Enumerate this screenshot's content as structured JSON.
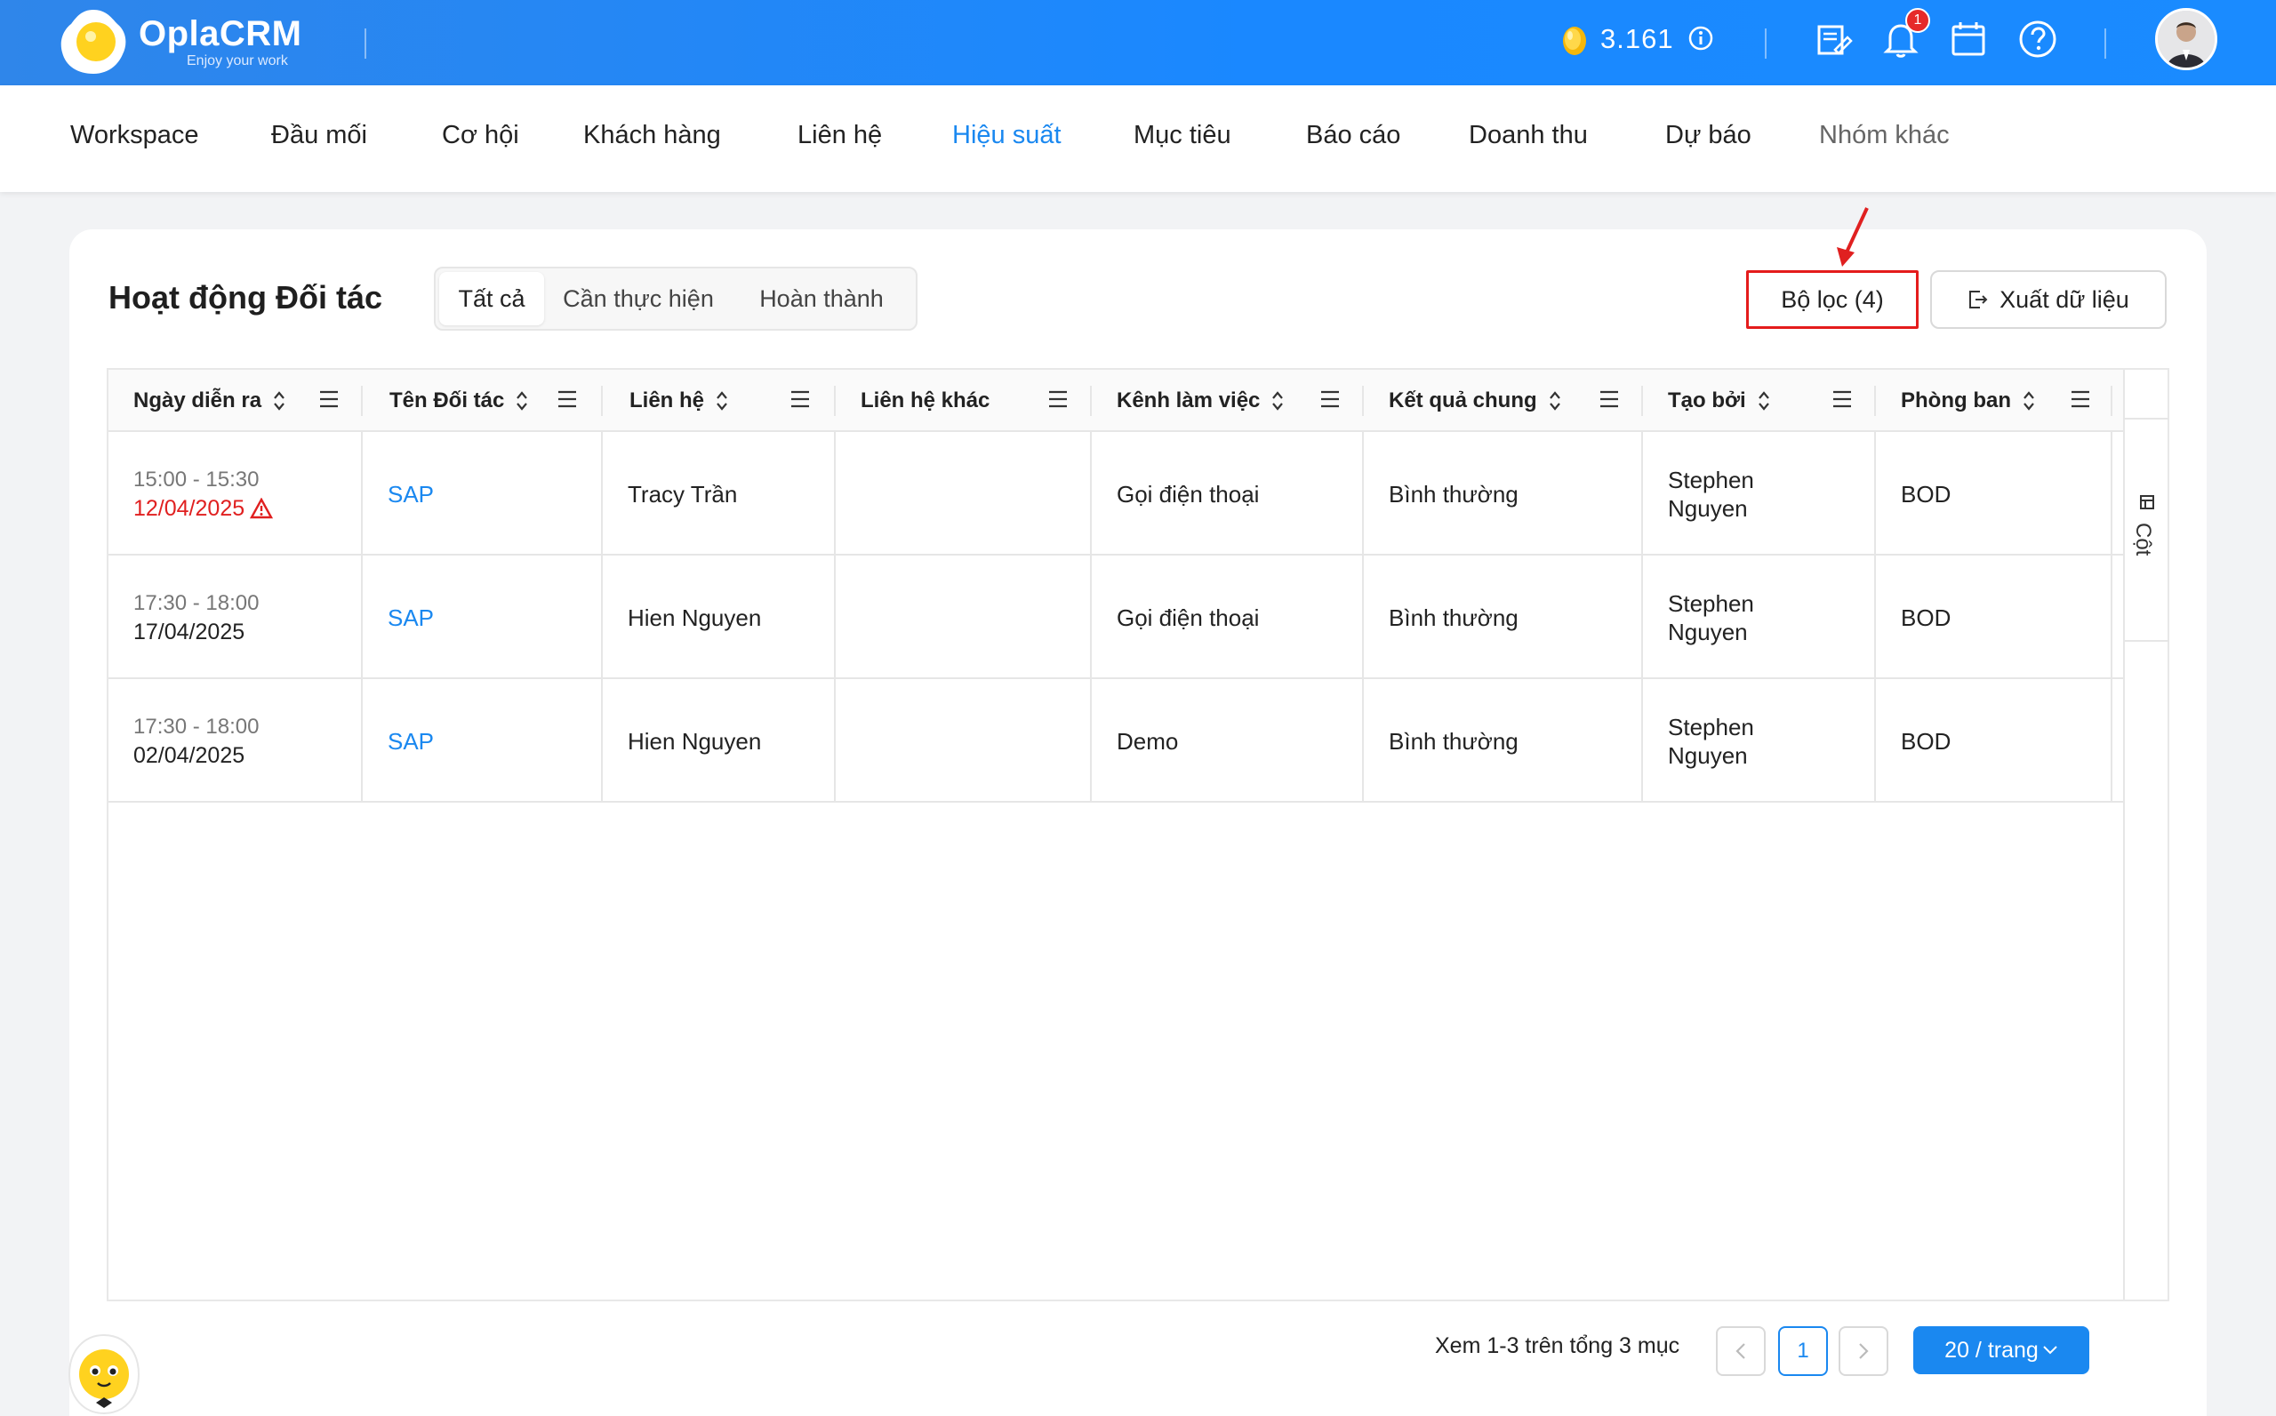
{
  "app": {
    "name": "OplaCRM",
    "tagline": "Enjoy your work",
    "coins": "3.161",
    "notification_count": "1"
  },
  "nav": {
    "items": [
      "Workspace",
      "Đầu mối",
      "Cơ hội",
      "Khách hàng",
      "Liên hệ",
      "Hiệu suất",
      "Mục tiêu",
      "Báo cáo",
      "Doanh thu",
      "Dự báo",
      "Nhóm khác"
    ],
    "active": "Hiệu suất"
  },
  "page": {
    "title": "Hoạt động Đối tác",
    "tabs": [
      "Tất cả",
      "Cần thực hiện",
      "Hoàn thành"
    ],
    "active_tab": "Tất cả",
    "filter_label": "Bộ lọc (4)",
    "export_label": "Xuất dữ liệu"
  },
  "table": {
    "columns": [
      "Ngày diễn ra",
      "Tên Đối tác",
      "Liên hệ",
      "Liên hệ khác",
      "Kênh làm việc",
      "Kết quả chung",
      "Tạo bởi",
      "Phòng ban"
    ],
    "rows": [
      {
        "time": "15:00 - 15:30",
        "date": "12/04/2025",
        "overdue": true,
        "partner": "SAP",
        "contact": "Tracy Trần",
        "other_contact": "",
        "channel": "Gọi điện thoại",
        "result": "Bình thường",
        "created_by": "Stephen Nguyen",
        "department": "BOD"
      },
      {
        "time": "17:30 - 18:00",
        "date": "17/04/2025",
        "overdue": false,
        "partner": "SAP",
        "contact": "Hien Nguyen",
        "other_contact": "",
        "channel": "Gọi điện thoại",
        "result": "Bình thường",
        "created_by": "Stephen Nguyen",
        "department": "BOD"
      },
      {
        "time": "17:30 - 18:00",
        "date": "02/04/2025",
        "overdue": false,
        "partner": "SAP",
        "contact": "Hien Nguyen",
        "other_contact": "",
        "channel": "Demo",
        "result": "Bình thường",
        "created_by": "Stephen Nguyen",
        "department": "BOD"
      }
    ],
    "side_label": "Cột"
  },
  "pagination": {
    "summary": "Xem 1-3 trên tổng 3 mục",
    "current_page": "1",
    "page_size": "20 / trang"
  },
  "colors": {
    "brand": "#1a88ff",
    "link": "#1a88f0",
    "alert": "#e02020",
    "highlight_box": "#e41c1c"
  }
}
